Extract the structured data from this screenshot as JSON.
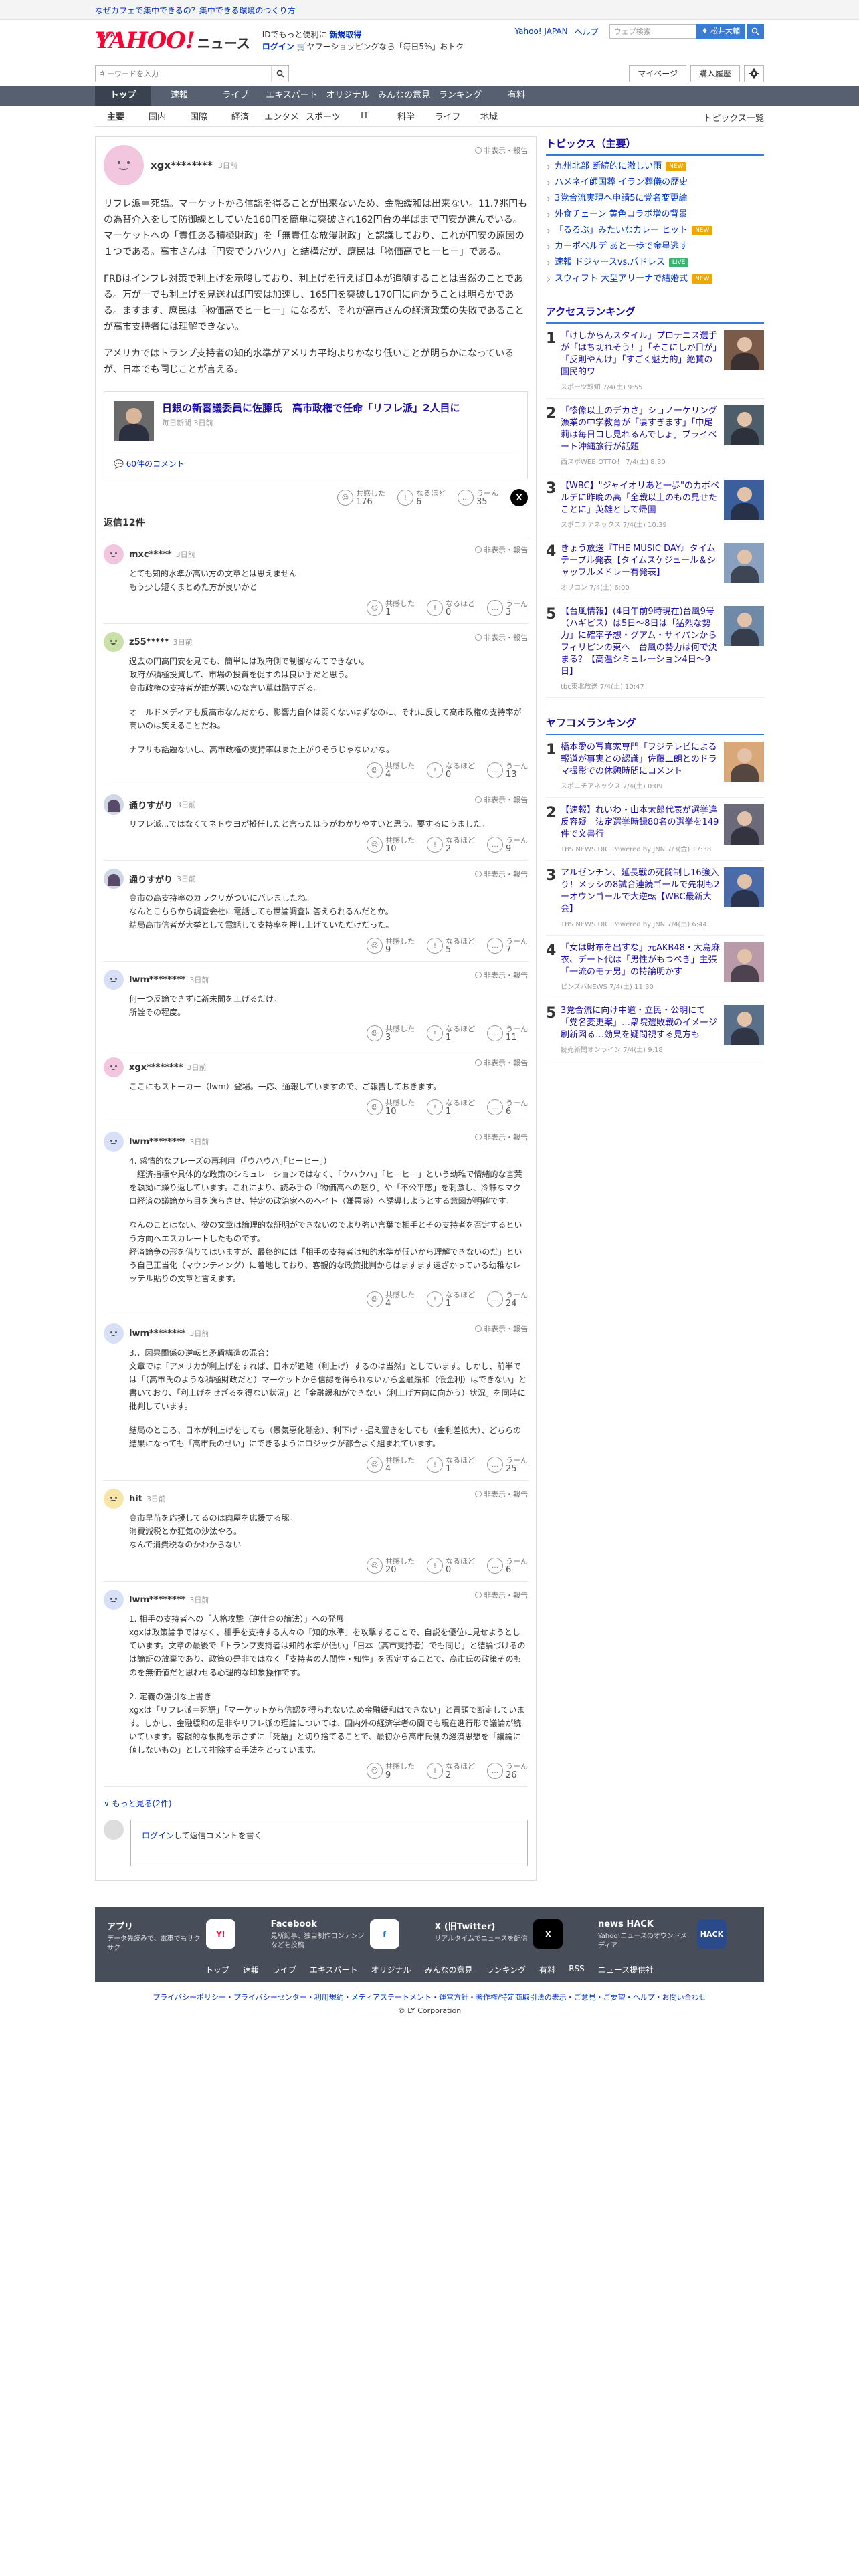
{
  "topbar": {
    "promo": "なぜカフェで集中できるの？集中できる環境のつくり方"
  },
  "header": {
    "logo_main": "YAHOO!",
    "logo_jp": "JAPAN",
    "logo_news": "ニュース",
    "promo_line1": "IDでもっと便利に",
    "promo_line1_bold": "新規取得",
    "login": "ログイン",
    "promo_line2": "ヤフーショッピングなら「毎日5%」おトク",
    "links": [
      "Yahoo! JAPAN",
      "ヘルプ"
    ],
    "search_placeholder": "ウェブ検索",
    "user_label": "松井大輔"
  },
  "search": {
    "placeholder": "キーワードを入力",
    "mypage": "マイページ",
    "purchase": "購入履歴"
  },
  "nav": [
    "トップ",
    "速報",
    "ライブ",
    "エキスパート",
    "オリジナル",
    "みんなの意見",
    "ランキング",
    "有料"
  ],
  "subnav": [
    "主要",
    "国内",
    "国際",
    "経済",
    "エンタメ",
    "スポーツ",
    "IT",
    "科学",
    "ライフ",
    "地域"
  ],
  "subnav_right": "トピックス一覧",
  "report_label": "非表示・報告",
  "original": {
    "user": "xgx********",
    "time": "3日前",
    "paragraphs": [
      "リフレ派＝死語。マーケットから信認を得ることが出来ないため、金融緩和は出来ない。11.7兆円もの為替介入をして防御線としていた160円を簡単に突破され162円台の半ばまで円安が進んでいる。マーケットへの「責任ある積極財政」を「無責任な放漫財政」と認識しており、これが円安の原因の１つである。高市さんは「円安でウハウハ」と結構だが、庶民は「物価高でヒーヒー」である。",
      "FRBはインフレ対策で利上げを示唆しており、利上げを行えば日本が追随することは当然のことである。万が一でも利上げを見送れば円安は加速し、165円を突破し170円に向かうことは明らかである。ますます、庶民は「物価高でヒーヒー」になるが、それが高市さんの経済政策の失敗であることが高市支持者には理解できない。",
      "アメリカではトランプ支持者の知的水準がアメリカ平均よりかなり低いことが明らかになっているが、日本でも同じことが言える。"
    ],
    "article_title": "日銀の新審議委員に佐藤氏　高市政権で任命「リフレ派」2人目に",
    "article_source": "毎日新聞 3日前",
    "article_comments": "60件のコメント",
    "reactions": {
      "empathy": "176",
      "naruhodo": "6",
      "uun": "35"
    }
  },
  "reactions_labels": {
    "empathy": "共感した",
    "naruhodo": "なるほど",
    "uun": "うーん"
  },
  "x_label": "X",
  "reply_count": "返信12件",
  "replies": [
    {
      "user": "mxc*****",
      "time": "3日前",
      "color": "#f3c6e0",
      "paras": [
        "とても知的水準が高い方の文章とは思えません\nもう少し短くまとめた方が良いかと"
      ],
      "r": [
        "1",
        "0",
        "3"
      ]
    },
    {
      "user": "z55*****",
      "time": "3日前",
      "color": "#c9e0a8",
      "paras": [
        "過去の円高円安を見ても、簡単には政府側で制御なんてできない。\n政府が積極投資して、市場の投資を促すのは良い手だと思う。\n高市政権の支持者が誰が悪いのな言い草は酷すぎる。",
        "オールドメディアも反高市なんだから、影響力自体は弱くないはずなのに、それに反して高市政権の支持率が高いのは笑えることだね。",
        "ナフサも話題ないし、高市政権の支持率はまた上がりそうじゃないかな。"
      ],
      "r": [
        "4",
        "0",
        "13"
      ]
    },
    {
      "user": "通りすがり",
      "time": "3日前",
      "color": "#ffffff",
      "photo": true,
      "paras": [
        "リフレ派...ではなくてネトウヨが擬任したと言ったほうがわかりやすいと思う。要するにうました。"
      ],
      "r": [
        "10",
        "2",
        "9"
      ]
    },
    {
      "user": "通りすがり",
      "time": "3日前",
      "color": "#ffffff",
      "photo": true,
      "paras": [
        "高市の高支持率のカラクリがついにバレましたね。\nなんとこちらから調査会社に電話しても世論調査に答えられるんだとか。\n結局高市信者が大挙として電話して支持率を押し上げていただけだった。"
      ],
      "r": [
        "9",
        "5",
        "7"
      ]
    },
    {
      "user": "lwm********",
      "time": "3日前",
      "color": "#d8e0f8",
      "paras": [
        "何一つ反論できずに新未開を上げるだけ。\n所詮その程度。"
      ],
      "r": [
        "3",
        "1",
        "11"
      ]
    },
    {
      "user": "xgx********",
      "time": "3日前",
      "color": "#f3c6e0",
      "paras": [
        "ここにもストーカー（lwm）登場。一応、通報していますので、ご報告しておきます。"
      ],
      "r": [
        "10",
        "1",
        "6"
      ]
    },
    {
      "user": "lwm********",
      "time": "3日前",
      "color": "#d8e0f8",
      "paras": [
        "4. 感情的なフレーズの再利用（｢ウハウハ｣｢ヒーヒー｣）\n　経済指標や具体的な政策のシミュレーションではなく、「ウハウハ」「ヒーヒー」という幼稚で情緒的な言葉を執拗に繰り返しています。これにより、読み手の「物価高への怒り」や「不公平感」を刺激し、冷静なマクロ経済の議論から目を逸らさせ、特定の政治家へのヘイト（嫌悪感）へ誘導しようとする意図が明確です。",
        "なんのことはない、彼の文章は論理的な証明ができないのでより強い言葉で相手とその支持者を否定するという方向へエスカレートしたものです。\n経済論争の形を借りてはいますが、最終的には「相手の支持者は知的水準が低いから理解できないのだ」という自己正当化（マウンティング）に着地しており、客観的な政策批判からはますます遠ざかっている幼稚なレッテル貼りの文章と言えます。"
      ],
      "r": [
        "4",
        "1",
        "24"
      ]
    },
    {
      "user": "lwm********",
      "time": "3日前",
      "color": "#d8e0f8",
      "paras": [
        "3.．因果関係の逆転と矛盾構造の混合：\n文章では「アメリカが利上げをすれば、日本が追随（利上げ）するのは当然」としています。しかし、前半では「（高市氏のような積極財政だと）マーケットから信認を得られないから金融緩和（低金利）はできない」と書いており、「利上げをせざるを得ない状況」と「金融緩和ができない（利上げ方向に向かう）状況」を同時に批判しています。",
        "結局のところ、日本が利上げをしても（景気悪化懸念）、利下げ・据え置きをしても（金利差拡大）、どちらの結果になっても「高市氏のせい」にできるようにロジックが都合よく組まれています。"
      ],
      "r": [
        "4",
        "1",
        "25"
      ]
    },
    {
      "user": "hit",
      "time": "3日前",
      "color": "#f8e6a8",
      "paras": [
        "高市早苗を応援してるのは肉屋を応援する豚。\n消費減税とか狂気の沙汰やろ。\nなんで消費税なのかわからない"
      ],
      "r": [
        "20",
        "0",
        "6"
      ]
    },
    {
      "user": "lwm********",
      "time": "3日前",
      "color": "#d8e0f8",
      "paras": [
        "1. 相手の支持者への「人格攻撃（逆仕合の論法）」への発展\nxgxは政策論争ではなく、相手を支持する人々の「知的水準」を攻撃することで、自説を優位に見せようとしています。文章の最後で「トランプ支持者は知的水準が低い」「日本（高市支持者）でも同じ」と結論づけるのは論証の放棄であり、政策の是非ではなく「支持者の人間性・知性」を否定することで、高市氏の政策そのものを無価値だと思わせる心理的な印象操作です。",
        "2. 定義の強引な上書き\nxgxは「リフレ派＝死語」「マーケットから信認を得られないため金融緩和はできない」と冒頭で断定しています。しかし、金融緩和の是非やリフレ派の理論については、国内外の経済学者の間でも現在進行形で議論が続いています。客観的な根拠を示さずに「死語」と切り捨てることで、最初から高市氏側の経済思想を「議論に値しないもの」として排除する手法をとっています。"
      ],
      "r": [
        "9",
        "2",
        "26"
      ]
    }
  ],
  "more_label": "もっと見る(2件)",
  "reply_input": {
    "login_link": "ログイン",
    "rest": "して返信コメントを書く"
  },
  "sidebar": {
    "topics_head": "トピックス（主要）",
    "topics": [
      {
        "text": "九州北部 断続的に激しい雨",
        "badge": "NEW",
        "type": "new"
      },
      {
        "text": "ハメネイ師国葬 イラン葬儀の歴史",
        "badge": "",
        "type": ""
      },
      {
        "text": "3党合流実現へ申請5に党名変更論",
        "badge": "",
        "type": ""
      },
      {
        "text": "外食チェーン 黄色コラボ増の背景",
        "badge": "",
        "type": ""
      },
      {
        "text": "「るるぶ」みたいなカレー ヒット",
        "badge": "NEW",
        "type": "new"
      },
      {
        "text": "カーボベルデ あと一歩で金星逃す",
        "badge": "",
        "type": ""
      },
      {
        "text": "速報 ドジャースvs.パドレス",
        "badge": "LIVE",
        "type": "live"
      },
      {
        "text": "スウィフト 大型アリーナで結婚式",
        "badge": "NEW",
        "type": "new"
      }
    ],
    "access_head": "アクセスランキング",
    "access": [
      {
        "n": "1",
        "title": "「けしからんスタイル」プロテニス選手が「はち切れそう！」「そこにしか目が」「反則やんけ」「すごく魅力的」絶賛の国民的ワ",
        "src": "スポーツ報知 7/4(土) 9:55",
        "thumb": "#7a5a48"
      },
      {
        "n": "2",
        "title": "「惨像以上のデカさ」ショノーケリング漁業の中学教育が「凄すぎます」「中尾莉は毎日コし見れるんでしょ」プライベート沖縄旅行が話題",
        "src": "西スポWEB OTTO！ 7/4(土) 8:30",
        "thumb": "#4d5e6a"
      },
      {
        "n": "3",
        "title": "【WBC】\"ジャイオリあと一歩\"のカボベルデに昨晩の高「全戦以上のもの見せたことに」英雄として帰国",
        "src": "スポニチアネックス 7/4(土) 10:39",
        "thumb": "#3b5f9a"
      },
      {
        "n": "4",
        "title": "きょう放送『THE MUSIC DAY』タイムテーブル発表【タイムスケジュール＆シャッフルメドレー有発表】",
        "src": "オリコン 7/4(土) 6:00",
        "thumb": "#8aa0c0"
      },
      {
        "n": "5",
        "title": "【台風情報】(4日午前9時現在)台風9号（ハギビス）は5日～8日は「猛烈な勢力」に確率予想・グアム・サイパンからフィリピンの東へ　台風の勢力は何で決まる？【高温シミュレーション4日～9日】",
        "src": "tbc東北放送 7/4(土) 10:47",
        "thumb": "#6f8aa8"
      }
    ],
    "yafuko_head": "ヤフコメランキング",
    "yafuko": [
      {
        "n": "1",
        "title": "橋本愛の写真家専門「フジテレビによる報道が事実との認識」佐藤二朗とのドラマ撮影での休憩時間にコメント",
        "src": "スポニチアネックス 7/4(土) 0:09",
        "thumb": "#d8a878"
      },
      {
        "n": "2",
        "title": "【速報】れいわ・山本太郎代表が選挙違反容疑　法定選挙時録80名の選挙を149件で文書行",
        "src": "TBS NEWS DIG Powered by JNN 7/3(金) 17:38",
        "thumb": "#6a6a7a"
      },
      {
        "n": "3",
        "title": "アルゼンチン、延長戦の死闘制し16強入り！メッシの8試合連続ゴールで先制も2ーオウンゴールで大逆転【WBC最新大会】",
        "src": "TBS NEWS DIG Powered by JNN 7/4(土) 6:44",
        "thumb": "#4b6aa8"
      },
      {
        "n": "4",
        "title": "「女は財布を出すな」元AKB48・大島麻衣、デート代は「男性がもつべき」主張　「一流のモテ男」の持論明かす",
        "src": "ピンズバNEWS 7/4(土) 11:30",
        "thumb": "#b89aa8"
      },
      {
        "n": "5",
        "title": "3党合流に向け中道・立民・公明にて「党名変更案」…衆院選敗戦のイメージ刷新図る…効果を疑問視する見方も",
        "src": "読売新聞オンライン 7/4(土) 9:18",
        "thumb": "#5a6f8a"
      }
    ]
  },
  "footer": {
    "apps": [
      {
        "t": "アプリ",
        "d": "データ先読みで、電車でもサクサク",
        "ic": "Y!",
        "bg": "#ffffff",
        "fg": "#ff0033"
      },
      {
        "t": "Facebook",
        "d": "見所記事、独自制作コンテンツなどを投稿",
        "ic": "f",
        "bg": "#ffffff",
        "fg": "#1877f2"
      },
      {
        "t": "X (旧Twitter)",
        "d": "リアルタイムでニュースを配信",
        "ic": "X",
        "bg": "#000000",
        "fg": "#ffffff"
      },
      {
        "t": "news HACK",
        "d": "Yahoo!ニュースのオウンドメディア",
        "ic": "HACK",
        "bg": "#2a4a8a",
        "fg": "#ffffff"
      }
    ],
    "links": [
      "トップ",
      "速報",
      "ライブ",
      "エキスパート",
      "オリジナル",
      "みんなの意見",
      "ランキング",
      "有料",
      "RSS",
      "ニュース提供社"
    ],
    "legal": "プライバシーポリシー・プライバシーセンター・利用規約・メディアステートメント・運営方針・著作権/特定商取引法の表示・ご意見・ご要望・ヘルプ・お問い合わせ",
    "copyright": "© LY Corporation"
  }
}
